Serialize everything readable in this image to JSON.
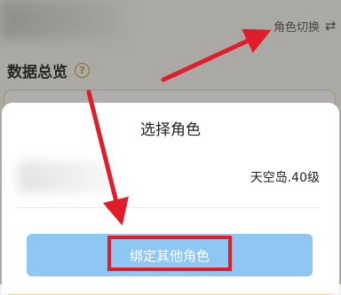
{
  "header": {
    "role_switch_label": "角色切换",
    "swap_icon": "⇄"
  },
  "overview": {
    "title": "数据总览",
    "help_icon": "?"
  },
  "modal": {
    "title": "选择角色",
    "role": {
      "server_level": "天空岛.40级"
    },
    "bind_button_label": "绑定其他角色"
  },
  "colors": {
    "accent_button": "#8ec7f4",
    "annotation_red": "#e01e2b"
  }
}
